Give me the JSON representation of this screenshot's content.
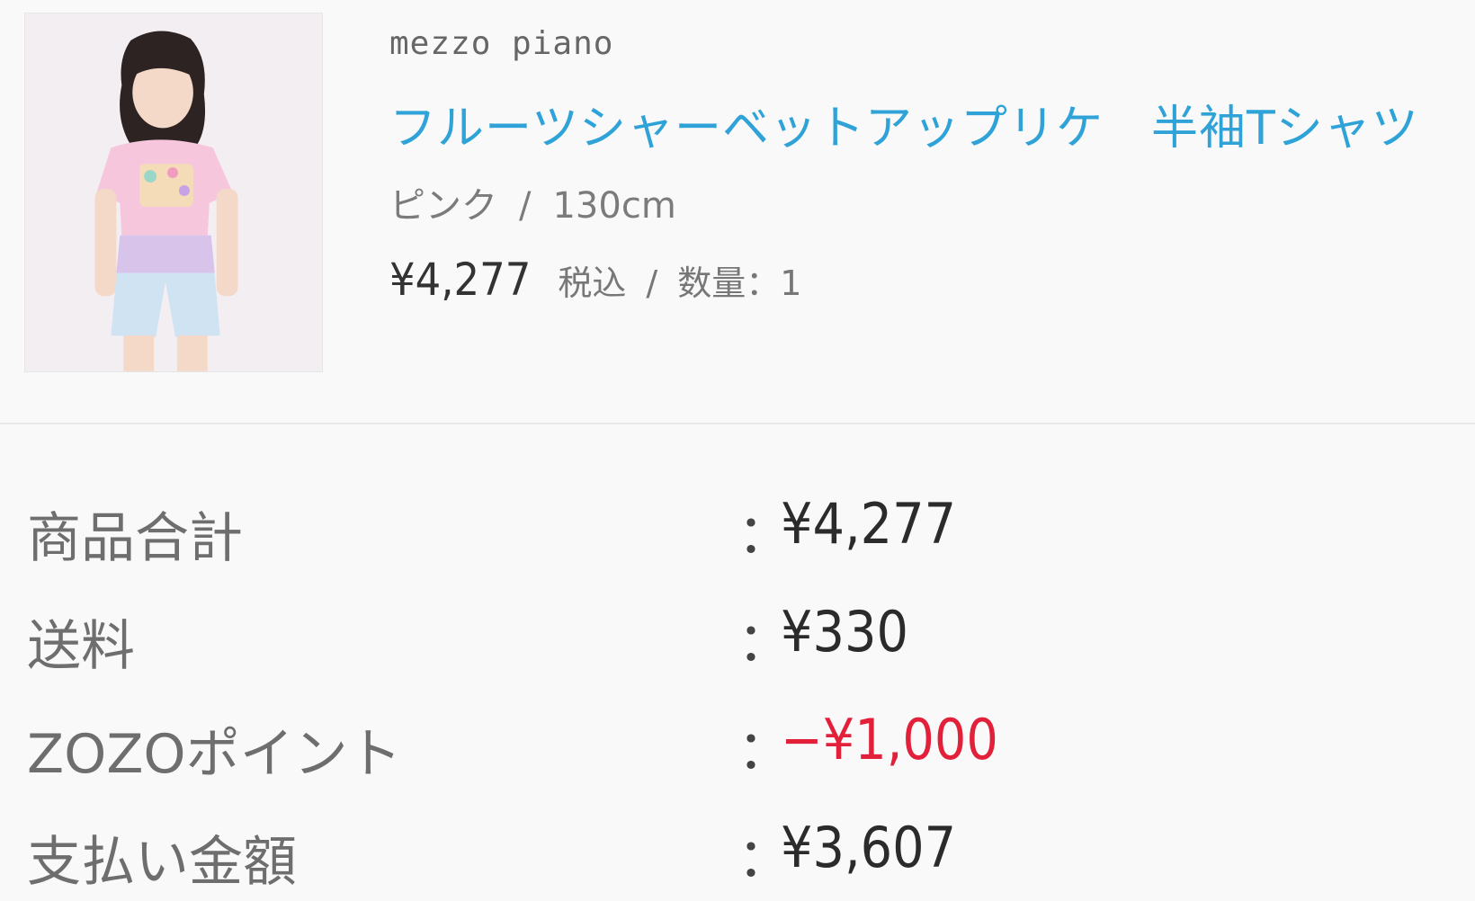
{
  "product": {
    "image_alt": "girl in pink t-shirt",
    "brand": "mezzo piano",
    "title": "フルーツシャーベットアップリケ　半袖Tシャツ",
    "color": "ピンク",
    "separator": "/",
    "size": "130cm",
    "price": "¥4,277",
    "tax_label": "税込",
    "quantity_label": "数量：1"
  },
  "summary": {
    "rows": [
      {
        "label": "商品合計",
        "colon": "：",
        "value": "¥4,277"
      },
      {
        "label": "送料",
        "colon": "：",
        "value": "¥330"
      },
      {
        "label": "ZOZOポイント",
        "colon": "：",
        "value": "−¥1,000"
      },
      {
        "label": "支払い金額",
        "colon": "：",
        "value": "¥3,607"
      }
    ]
  },
  "colors": {
    "title": "#2fa3d8",
    "discount": "#e2203a",
    "label": "#6e6e6e"
  }
}
